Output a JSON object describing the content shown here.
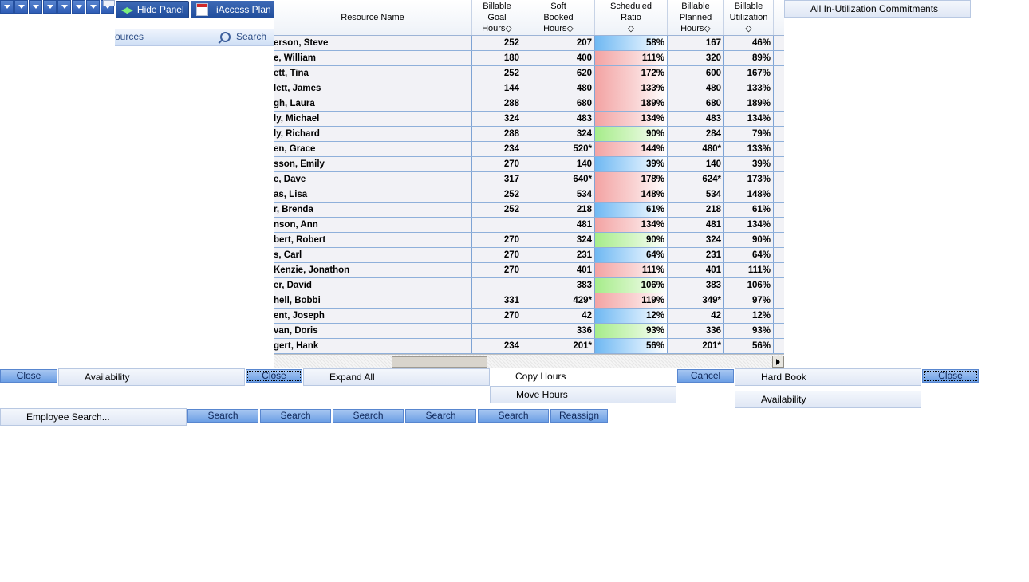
{
  "toolbar": {
    "hide_panel_label": "Hide Panel",
    "iaccess_label": "iAccess Plan",
    "resources_label": "ources",
    "search_label": "Search"
  },
  "grid": {
    "columns": [
      {
        "key": "name",
        "label": "Resource Name"
      },
      {
        "key": "goal",
        "label": "Billable Goal Hours◇"
      },
      {
        "key": "soft",
        "label": "Soft Booked Hours◇"
      },
      {
        "key": "ratio",
        "label": "Scheduled Ratio ◇"
      },
      {
        "key": "planned",
        "label": "Billable Planned Hours◇"
      },
      {
        "key": "util",
        "label": "Billable Utilization ◇"
      }
    ],
    "rows": [
      {
        "name": "erson, Steve",
        "goal": "252",
        "soft": "207",
        "ratio": "58%",
        "rc": "blue",
        "planned": "167",
        "util": "46%"
      },
      {
        "name": "e, William",
        "goal": "180",
        "soft": "400",
        "ratio": "111%",
        "rc": "red",
        "planned": "320",
        "util": "89%"
      },
      {
        "name": "ett, Tina",
        "goal": "252",
        "soft": "620",
        "ratio": "172%",
        "rc": "red",
        "planned": "600",
        "util": "167%"
      },
      {
        "name": "lett, James",
        "goal": "144",
        "soft": "480",
        "ratio": "133%",
        "rc": "red",
        "planned": "480",
        "util": "133%"
      },
      {
        "name": "gh, Laura",
        "goal": "288",
        "soft": "680",
        "ratio": "189%",
        "rc": "red",
        "planned": "680",
        "util": "189%"
      },
      {
        "name": "ly, Michael",
        "goal": "324",
        "soft": "483",
        "ratio": "134%",
        "rc": "red",
        "planned": "483",
        "util": "134%"
      },
      {
        "name": "ly, Richard",
        "goal": "288",
        "soft": "324",
        "ratio": "90%",
        "rc": "green",
        "planned": "284",
        "util": "79%"
      },
      {
        "name": "en, Grace",
        "goal": "234",
        "soft": "520*",
        "ratio": "144%",
        "rc": "red",
        "planned": "480*",
        "util": "133%"
      },
      {
        "name": "sson, Emily",
        "goal": "270",
        "soft": "140",
        "ratio": "39%",
        "rc": "blue",
        "planned": "140",
        "util": "39%"
      },
      {
        "name": "e, Dave",
        "goal": "317",
        "soft": "640*",
        "ratio": "178%",
        "rc": "red",
        "planned": "624*",
        "util": "173%"
      },
      {
        "name": "as, Lisa",
        "goal": "252",
        "soft": "534",
        "ratio": "148%",
        "rc": "red",
        "planned": "534",
        "util": "148%"
      },
      {
        "name": "r, Brenda",
        "goal": "252",
        "soft": "218",
        "ratio": "61%",
        "rc": "blue",
        "planned": "218",
        "util": "61%"
      },
      {
        "name": "nson, Ann",
        "goal": "",
        "soft": "481",
        "ratio": "134%",
        "rc": "red",
        "planned": "481",
        "util": "134%"
      },
      {
        "name": "bert, Robert",
        "goal": "270",
        "soft": "324",
        "ratio": "90%",
        "rc": "green",
        "planned": "324",
        "util": "90%"
      },
      {
        "name": "s, Carl",
        "goal": "270",
        "soft": "231",
        "ratio": "64%",
        "rc": "blue",
        "planned": "231",
        "util": "64%"
      },
      {
        "name": "Kenzie, Jonathon",
        "goal": "270",
        "soft": "401",
        "ratio": "111%",
        "rc": "red",
        "planned": "401",
        "util": "111%"
      },
      {
        "name": "er, David",
        "goal": "",
        "soft": "383",
        "ratio": "106%",
        "rc": "green",
        "planned": "383",
        "util": "106%"
      },
      {
        "name": "hell, Bobbi",
        "goal": "331",
        "soft": "429*",
        "ratio": "119%",
        "rc": "red",
        "planned": "349*",
        "util": "97%"
      },
      {
        "name": "ent, Joseph",
        "goal": "270",
        "soft": "42",
        "ratio": "12%",
        "rc": "blue",
        "planned": "42",
        "util": "12%"
      },
      {
        "name": "van, Doris",
        "goal": "",
        "soft": "336",
        "ratio": "93%",
        "rc": "green",
        "planned": "336",
        "util": "93%"
      },
      {
        "name": "gert, Hank",
        "goal": "234",
        "soft": "201*",
        "ratio": "56%",
        "rc": "blue",
        "planned": "201*",
        "util": "56%"
      }
    ]
  },
  "commitments_label": "All In-Utilization Commitments",
  "buttons": {
    "close1": "Close",
    "availability1": "Availability",
    "close2": "Close",
    "expand_all": "Expand All",
    "copy_hours": "Copy Hours",
    "move_hours": "Move Hours",
    "cancel": "Cancel",
    "hard_book": "Hard Book",
    "availability2": "Availability",
    "close3": "Close",
    "employee_search": "Employee Search...",
    "search1": "Search",
    "search2": "Search",
    "search3": "Search",
    "search4": "Search",
    "search5": "Search",
    "reassign": "Reassign"
  },
  "colors": {
    "ratio_blue": "#6fb8f2",
    "ratio_red": "#f3a3a3",
    "ratio_green": "#a6ec8a",
    "toolbar": "#2a579f"
  }
}
